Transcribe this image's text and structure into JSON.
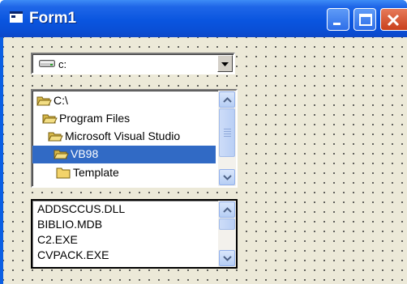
{
  "window": {
    "title": "Form1"
  },
  "drive_list": {
    "selected": "c:",
    "icon": "drive-icon"
  },
  "dir_list": {
    "items": [
      {
        "label": "C:\\",
        "icon": "open-folder-icon",
        "selected": false
      },
      {
        "label": "Program Files",
        "icon": "open-folder-icon",
        "selected": false
      },
      {
        "label": "Microsoft Visual Studio",
        "icon": "open-folder-icon",
        "selected": false
      },
      {
        "label": "VB98",
        "icon": "open-folder-icon",
        "selected": true
      },
      {
        "label": "Template",
        "icon": "folder-icon",
        "selected": false
      }
    ]
  },
  "file_list": {
    "items": [
      "ADDSCCUS.DLL",
      "BIBLIO.MDB",
      "C2.EXE",
      "CVPACK.EXE"
    ]
  },
  "colors": {
    "titlebar": "#0a55df",
    "selection": "#316ac5",
    "form_background": "#ece9d8",
    "close_button": "#c9401c"
  }
}
